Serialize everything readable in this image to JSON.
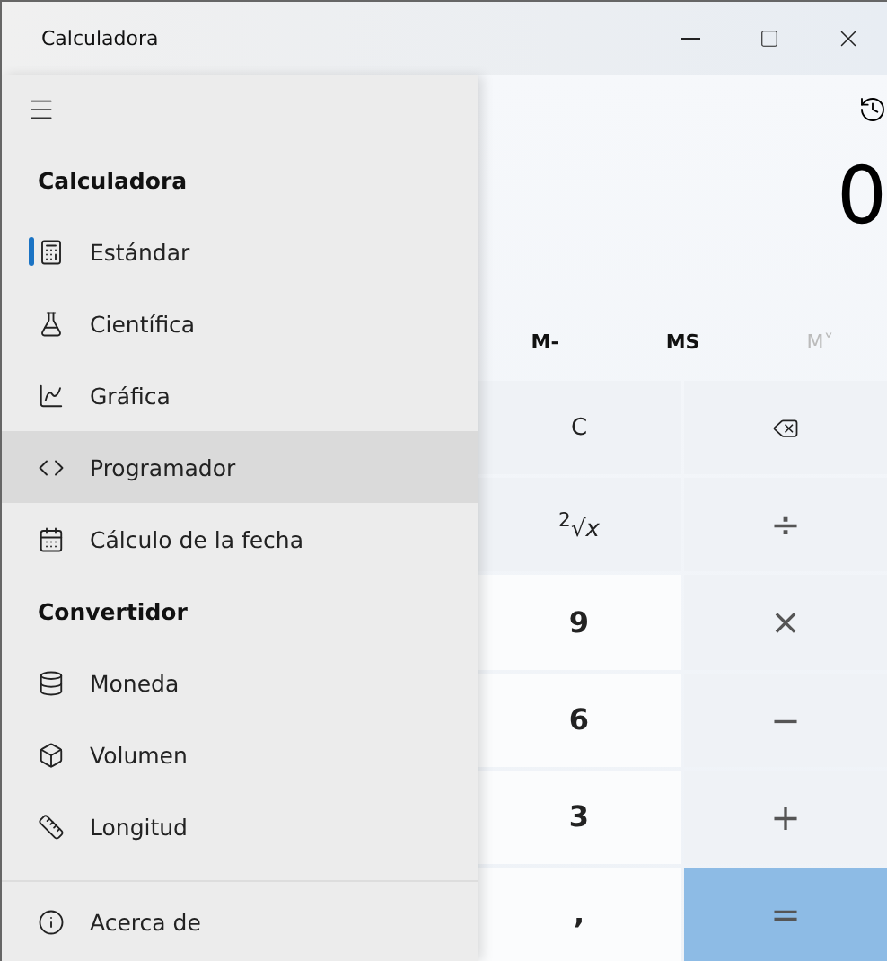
{
  "window": {
    "title": "Calculadora"
  },
  "nav": {
    "sections": [
      {
        "heading": "Calculadora",
        "items": [
          {
            "label": "Estándar",
            "selected": true,
            "hovered": false
          },
          {
            "label": "Científica",
            "selected": false,
            "hovered": false
          },
          {
            "label": "Gráfica",
            "selected": false,
            "hovered": false
          },
          {
            "label": "Programador",
            "selected": false,
            "hovered": true
          },
          {
            "label": "Cálculo de la fecha",
            "selected": false,
            "hovered": false
          }
        ]
      },
      {
        "heading": "Convertidor",
        "items": [
          {
            "label": "Moneda",
            "selected": false,
            "hovered": false
          },
          {
            "label": "Volumen",
            "selected": false,
            "hovered": false
          },
          {
            "label": "Longitud",
            "selected": false,
            "hovered": false
          }
        ]
      }
    ],
    "footer": {
      "label": "Acerca de"
    }
  },
  "display": {
    "value": "0"
  },
  "memory": [
    {
      "label": "M-",
      "disabled": false
    },
    {
      "label": "MS",
      "disabled": false
    },
    {
      "label": "M˅",
      "disabled": true
    }
  ],
  "keys": [
    {
      "label": "C",
      "kind": "function"
    },
    {
      "kind": "backspace"
    },
    {
      "label": "$^{2}$√*x*",
      "kind": "function"
    },
    {
      "label": "÷",
      "kind": "operator"
    },
    {
      "label": "9",
      "kind": "digit"
    },
    {
      "label": "×",
      "kind": "operator"
    },
    {
      "label": "6",
      "kind": "digit"
    },
    {
      "label": "−",
      "kind": "operator"
    },
    {
      "label": "3",
      "kind": "digit"
    },
    {
      "label": "+",
      "kind": "operator"
    },
    {
      "label": ",",
      "kind": "digit"
    },
    {
      "label": "=",
      "kind": "equals"
    }
  ]
}
